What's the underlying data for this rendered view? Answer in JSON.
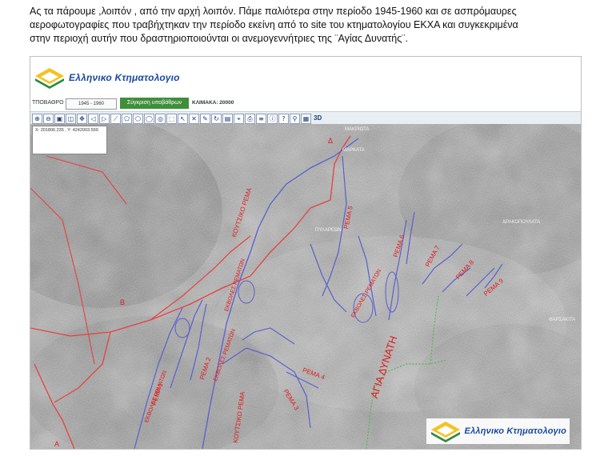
{
  "paragraph": {
    "line1": "Ας τα πάρουμε ,λοιπόν , από την αρχή λοιπόν. Πάμε παλιότερα στην περίοδο 1945-1960 και σε ασπρόμαυρες",
    "line2": "αεροφωτογραφίες που τραβήχτηκαν την περίοδο εκείνη από το site του κτηματολογίου ΕΚΧΑ και συγκεκριμένα",
    "line3": "στην περιοχή αυτήν που δραστηριοποιούνται οι ανεμογεννήτριες της ¨Αγίας Δυνατής¨."
  },
  "header": {
    "logo_text": "Ελληνικο Κτηματολογιο"
  },
  "controls": {
    "label": "ΤΠΟΒΑΘΡΟ",
    "select_value": "1945 - 1960",
    "compare_button": "Σύγκριση υποβάθρων",
    "scale": "ΚΛΙΜΑΚΑ: 20000"
  },
  "toolbar": {
    "three_d_label": "3D"
  },
  "map": {
    "coord_readout": "Χ: 201806.235 , Υ: 4242003.599",
    "colors": {
      "road": "#e8403f",
      "stream": "#5a5fcf",
      "boundary": "#53b853",
      "label": "#e31a1a"
    },
    "place_labels": [
      "ΜΑΚΡΙΩΤΑ",
      "ΜΑΡΚΑΤΑ",
      "ΠΥΛΑΡΕΩΝ",
      "ΔΡΑΚΟΠΟΥΛΑΤΑ",
      "ΦΑΡΣΑΚΙΤΑ"
    ],
    "road_labels": [
      "Δ",
      "Β",
      "Α"
    ],
    "stream_labels": {
      "koutsiko": "ΚΟΥΤΣΙΚΟ ΡΕΜΑ",
      "r5": "ΡΕΜΑ 5",
      "r6": "ΡΕΜΑ 6",
      "r7": "ΡΕΜΑ 7",
      "r8": "ΡΕΜΑ 8",
      "r9": "ΡΕΜΑ 9",
      "r1": "ΡΕΜΑ 1",
      "r2": "ΡΕΜΑ 2",
      "r3": "ΡΕΜΑ 3",
      "r4": "ΡΕΜΑ 4",
      "koutsiko2": "ΚΟΥΤΣΙΚΟ ΡΕΜΑ"
    },
    "area_labels": {
      "ekvoles1": "ΕΚΒΟΛΕΣ ΡΕΜΑΤΩΝ",
      "ekvoles2": "ΕΚΒΟΛΕΣ ΡΕΜΑΤΩΝ",
      "ekvoles3": "ΕΚΒΟΛΕΣ ΡΕΜΑΤΩΝ",
      "ekvoles4": "ΕΚΒΟΛΕΣ ΡΕΜΑΤΩΝ"
    },
    "region_label": "ΑΓΙΑ ΔΥΝΑΤΗ",
    "bottom_logo_text": "Ελληνικο Κτηματολογιο"
  }
}
